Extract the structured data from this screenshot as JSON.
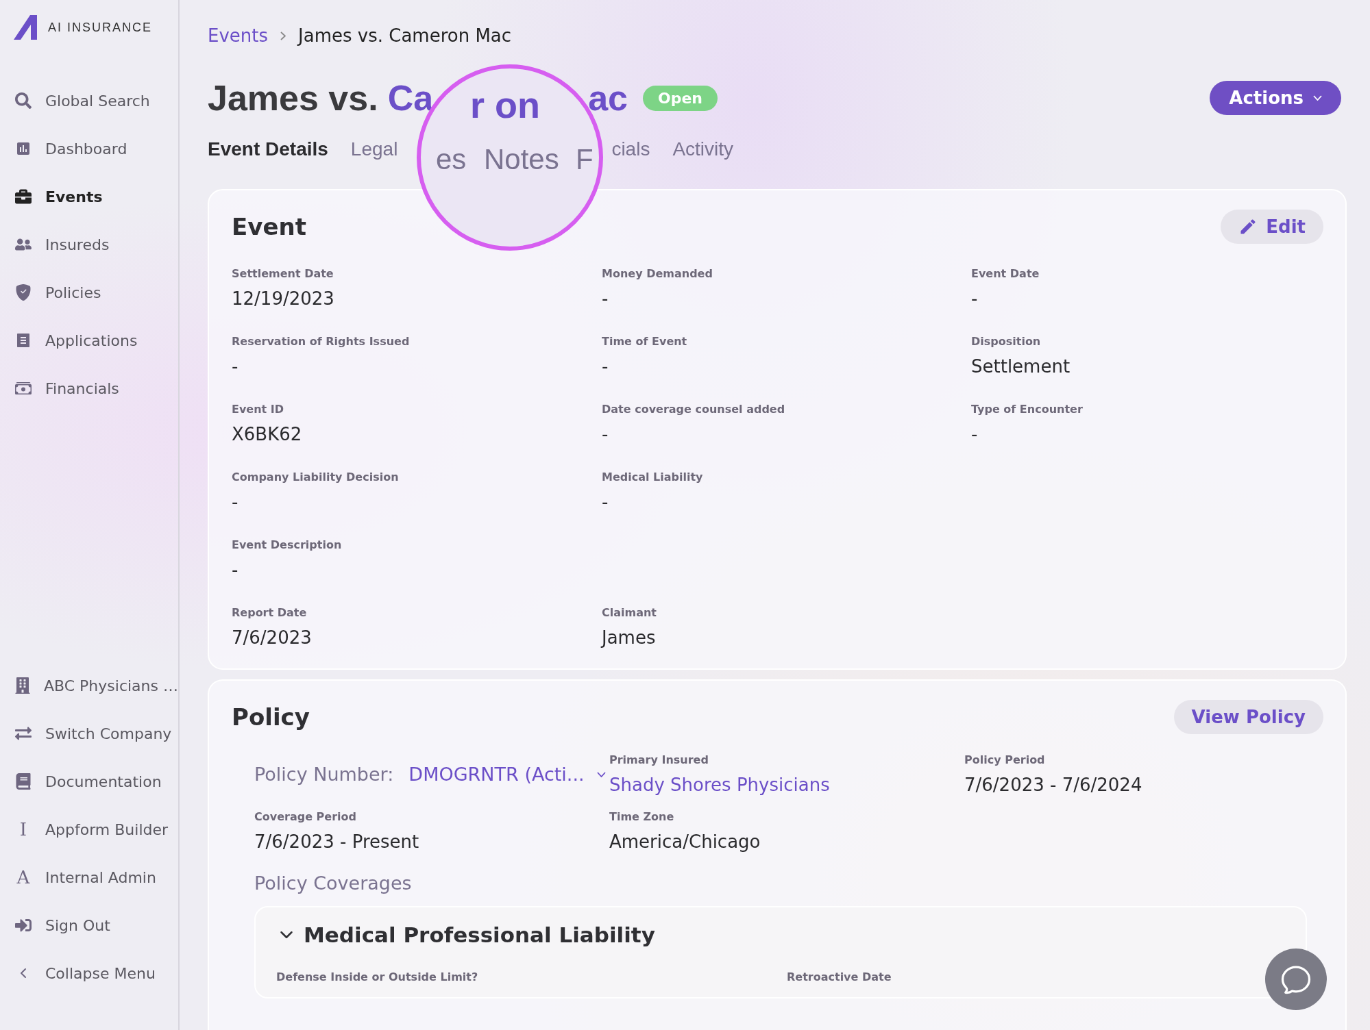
{
  "sidebar": {
    "logo": "AI INSURANCE",
    "items": [
      {
        "label": "Global Search",
        "selected": false
      },
      {
        "label": "Dashboard",
        "selected": false
      },
      {
        "label": "Events",
        "selected": true
      },
      {
        "label": "Insureds",
        "selected": false
      },
      {
        "label": "Policies",
        "selected": false
      },
      {
        "label": "Applications",
        "selected": false
      },
      {
        "label": "Financials",
        "selected": false
      }
    ],
    "bottom_items": [
      {
        "label": "ABC Physicians …"
      },
      {
        "label": "Switch Company"
      },
      {
        "label": "Documentation"
      },
      {
        "label": "Appform Builder",
        "glyph": "I"
      },
      {
        "label": "Internal Admin",
        "glyph": "A"
      },
      {
        "label": "Sign Out"
      },
      {
        "label": "Collapse Menu"
      }
    ]
  },
  "breadcrumb": [
    {
      "label": "Events",
      "kind": "link"
    },
    {
      "label": "James vs. Cameron Mac",
      "kind": "current"
    }
  ],
  "header": {
    "title_prefix": "James vs.",
    "title_parts": [
      "Ca",
      "ac"
    ],
    "status": "Open",
    "actions": "Actions"
  },
  "tabs": [
    {
      "label": "Event Details",
      "selected": true
    },
    {
      "label": "Legal",
      "selected": false
    },
    {
      "label": "cials",
      "selected": false
    },
    {
      "label": "Activity",
      "selected": false
    }
  ],
  "magnifier": {
    "title_fragment": "r on",
    "tabs": [
      "es",
      "Notes",
      "F"
    ]
  },
  "event": {
    "title": "Event",
    "edit": "Edit",
    "rows": [
      [
        {
          "label": "Settlement Date",
          "value": "12/19/2023"
        },
        {
          "label": "Money Demanded",
          "value": "-"
        },
        {
          "label": "Event Date",
          "value": "-"
        }
      ],
      [
        {
          "label": "Reservation of Rights Issued",
          "value": "-"
        },
        {
          "label": "Time of Event",
          "value": "-"
        },
        {
          "label": "Disposition",
          "value": "Settlement"
        }
      ],
      [
        {
          "label": "Event ID",
          "value": "X6BK62"
        },
        {
          "label": "Date coverage counsel added",
          "value": "-"
        },
        {
          "label": "Type of Encounter",
          "value": "-"
        }
      ],
      [
        {
          "label": "Company Liability Decision",
          "value": "-"
        },
        {
          "label": "Medical Liability",
          "value": "-"
        }
      ],
      [
        {
          "label": "Event Description",
          "value": "-"
        }
      ],
      [
        {
          "label": "Report Date",
          "value": "7/6/2023"
        },
        {
          "label": "Claimant",
          "value": "James"
        }
      ]
    ]
  },
  "policy": {
    "title": "Policy",
    "view": "View Policy",
    "number_label": "Policy Number:",
    "number": "DMOGRNTR (Acti...",
    "primary_insured": {
      "label": "Primary Insured",
      "value": "Shady Shores Physicians"
    },
    "policy_period": {
      "label": "Policy Period",
      "value": "7/6/2023 - 7/6/2024"
    },
    "coverage_period": {
      "label": "Coverage Period",
      "value": "7/6/2023 - Present"
    },
    "time_zone": {
      "label": "Time Zone",
      "value": "America/Chicago"
    },
    "coverages_title": "Policy Coverages",
    "coverage": {
      "title": "Medical Professional Liability",
      "expanded": true,
      "labels": [
        "Defense Inside or Outside Limit?",
        "Retroactive Date"
      ]
    }
  }
}
